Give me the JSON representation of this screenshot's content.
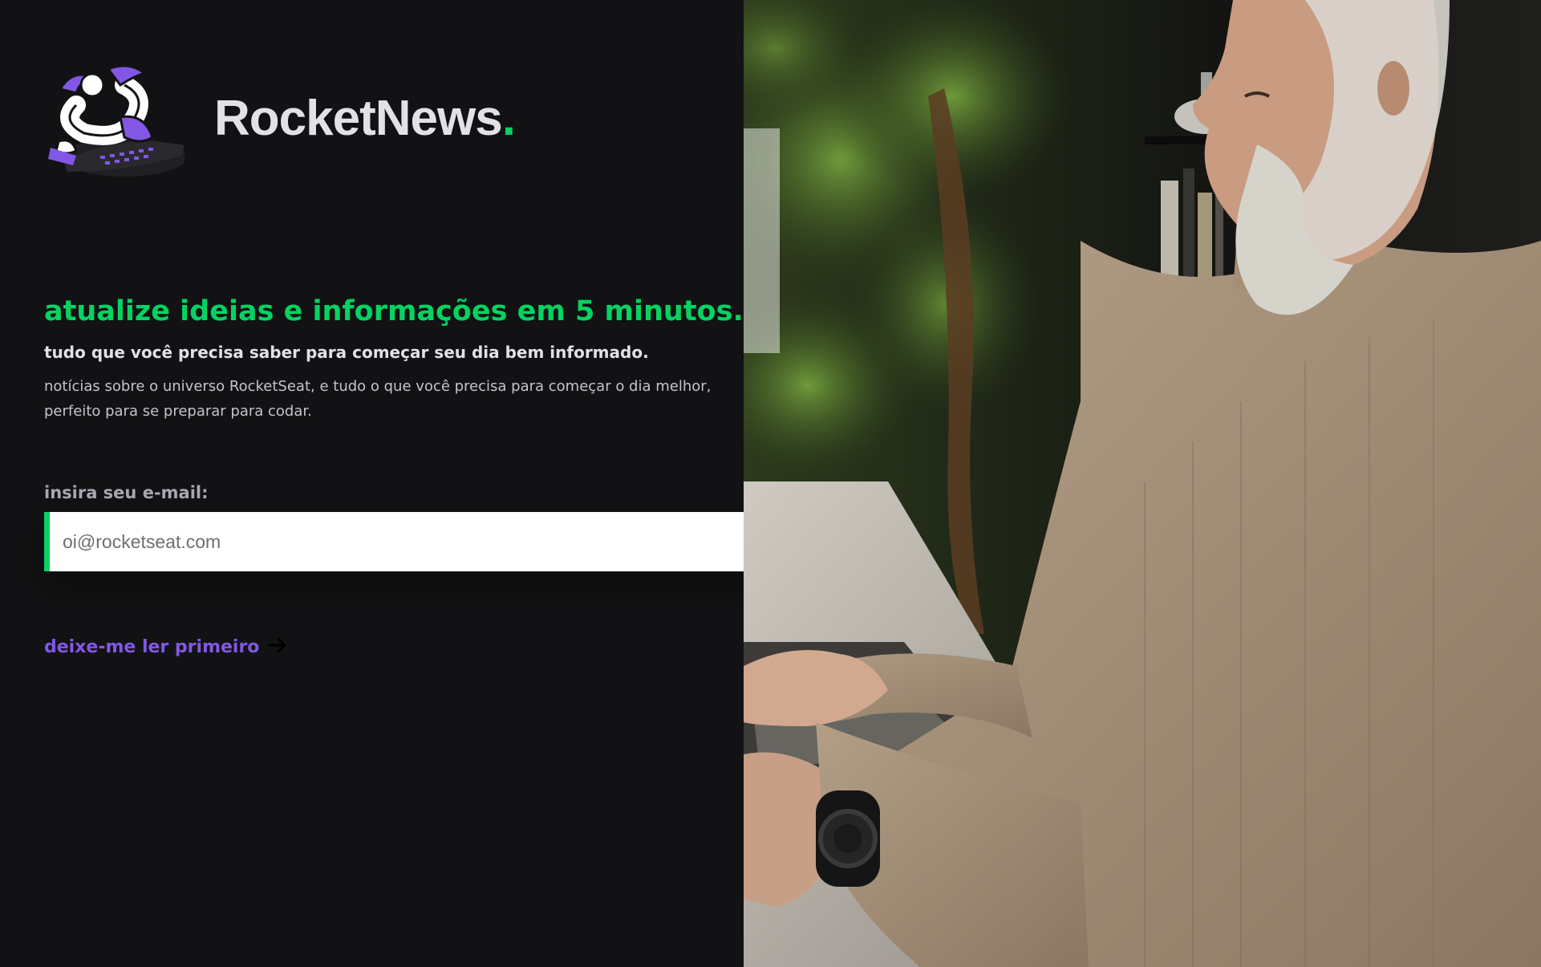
{
  "brand": {
    "name": "RocketNews",
    "dot": ".",
    "logo_icon": "rocketseat-mascot-illustration"
  },
  "hero": {
    "headline": "atualize ideias e informações em 5 minutos.",
    "subhead": "tudo que você precisa saber para começar seu dia bem informado.",
    "description": "notícias sobre o universo RocketSeat, e tudo o que você precisa para começar o dia melhor, perfeito para se preparar para codar."
  },
  "form": {
    "label": "insira seu e-mail:",
    "placeholder": "oi@rocketseat.com",
    "value": "",
    "submit_icon": "send-icon"
  },
  "link": {
    "label": "deixe-me ler primeiro",
    "icon": "arrow-right-icon"
  },
  "photo": {
    "subject": "man-typing-on-laptop-photo"
  },
  "colors": {
    "background": "#121214",
    "accent_green": "#04d361",
    "accent_purple": "#8257e5",
    "text_light": "#e1e1e6"
  }
}
